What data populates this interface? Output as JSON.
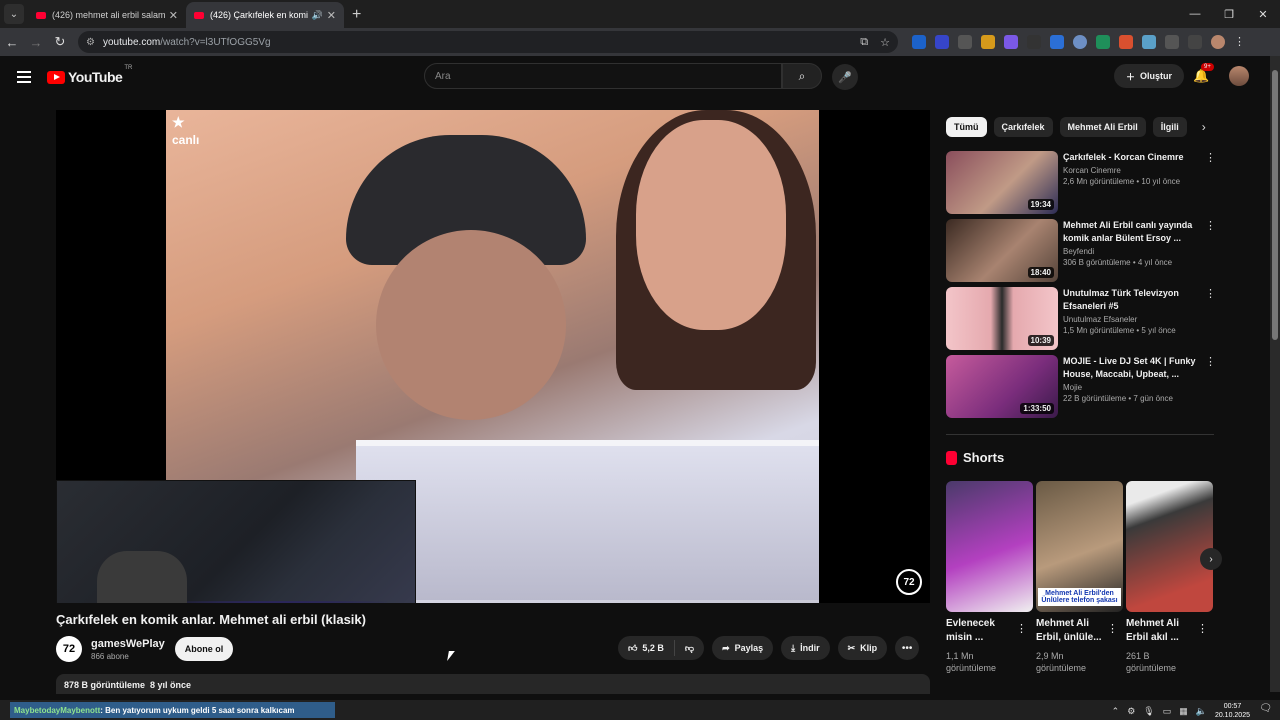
{
  "browser": {
    "tabs": [
      {
        "title": "(426) mehmet ali erbil salam - Y",
        "active": false
      },
      {
        "title": "(426) Çarkıfelek en komik a",
        "active": true
      }
    ],
    "url_host": "youtube.com",
    "url_path": "/watch?v=l3UTfOGG5Vg"
  },
  "youtube": {
    "logo_text": "YouTube",
    "region": "TR",
    "search_placeholder": "Ara",
    "create_label": "Oluştur",
    "notif_badge": "9+"
  },
  "video": {
    "title": "Çarkıfelek en komik anlar. Mehmet ali erbil (klasik)",
    "stamp": "canlı",
    "channel_logo": "72",
    "channel_name": "gamesWePlay",
    "subscribers": "866 abone",
    "subscribe_label": "Abone ol",
    "likes": "5,2 B",
    "share_label": "Paylaş",
    "download_label": "İndir",
    "clip_label": "Klip",
    "views": "878 B görüntüleme",
    "age": "8 yıl önce"
  },
  "chips": [
    "Tümü",
    "Çarkıfelek",
    "Mehmet Ali Erbil",
    "İlgili"
  ],
  "recommendations": [
    {
      "title": "Çarkıfelek - Korcan Cinemre",
      "channel": "Korcan Cinemre",
      "views": "2,6 Mn görüntüleme",
      "age": "10 yıl önce",
      "duration": "19:34",
      "color": "#8a4e5c"
    },
    {
      "title": "Mehmet Ali Erbil  canlı yayında komik anlar  Bülent Ersoy ...",
      "channel": "Beyfendi",
      "views": "306 B görüntüleme",
      "age": "4 yıl önce",
      "duration": "18:40",
      "color": "#5e4a40"
    },
    {
      "title": "Unutulmaz Türk Televizyon Efsaneleri #5",
      "channel": "Unutulmaz Efsaneler",
      "views": "1,5 Mn görüntüleme",
      "age": "5 yıl önce",
      "duration": "10:39",
      "color": "#e9b5b9"
    },
    {
      "title": "MOJIE - Live DJ Set 4K | Funky House, Maccabi, Upbeat, ...",
      "channel": "Mojie",
      "views": "22 B görüntüleme",
      "age": "7 gün önce",
      "duration": "1:33:50",
      "color": "#c65b9c"
    }
  ],
  "shorts": {
    "heading": "Shorts",
    "items": [
      {
        "title": "Evlenecek misin ...",
        "views": "1,1 Mn görüntüleme",
        "caption": "",
        "color": "#9a2fa8"
      },
      {
        "title": "Mehmet Ali Erbil, ünlüle...",
        "views": "2,9 Mn görüntüleme",
        "caption": "Mehmet Ali Erbil'den Ünlülere telefon şakası",
        "color": "#7a6b55"
      },
      {
        "title": "Mehmet Ali Erbil akıl ...",
        "views": "261 B görüntüleme",
        "caption": "",
        "color": "#c0473e"
      }
    ]
  },
  "taskbar": {
    "ticker_user": "MaybetodayMaybenott",
    "ticker_text": ": Ben yatıyorum uykum geldi 5 saat sonra kalkıcam",
    "time": "00:57",
    "date": "20.10.2025"
  }
}
